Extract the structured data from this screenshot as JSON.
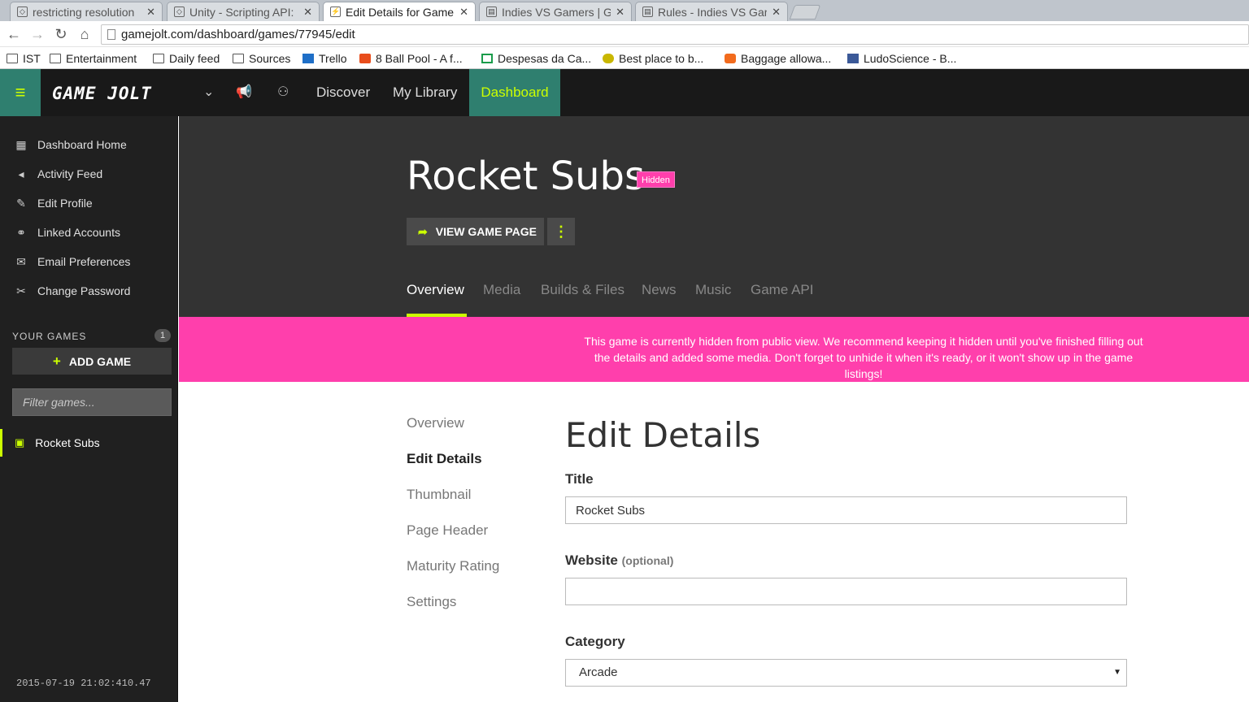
{
  "browser": {
    "tabs": [
      {
        "label": "restricting resolution",
        "favicon": "unity-icon"
      },
      {
        "label": "Unity - Scripting API:",
        "favicon": "unity-icon"
      },
      {
        "label": "Edit Details for Game",
        "favicon": "gamejolt-icon"
      },
      {
        "label": "Indies VS Gamers | G",
        "favicon": "forum-icon"
      },
      {
        "label": "Rules - Indies VS Gar",
        "favicon": "forum-icon"
      }
    ],
    "url": "gamejolt.com/dashboard/games/77945/edit",
    "bookmarks": [
      {
        "label": "IST",
        "icon": "folder-icon"
      },
      {
        "label": "Entertainment",
        "icon": "folder-icon"
      },
      {
        "label": "Daily feed",
        "icon": "folder-icon"
      },
      {
        "label": "Sources",
        "icon": "folder-icon"
      },
      {
        "label": "Trello",
        "icon": "trello-icon"
      },
      {
        "label": "8 Ball Pool - A f...",
        "icon": "play-icon"
      },
      {
        "label": "Despesas da Ca...",
        "icon": "sheets-icon"
      },
      {
        "label": "Best place to b...",
        "icon": "smiley-icon"
      },
      {
        "label": "Baggage allowa...",
        "icon": "e-icon"
      },
      {
        "label": "LudoScience - B...",
        "icon": "facebook-icon"
      }
    ]
  },
  "header": {
    "logo": "GAME JOLT",
    "nav": {
      "discover": "Discover",
      "library": "My Library",
      "dashboard": "Dashboard"
    },
    "accent": "#ccff00",
    "brand": "#2f7f6f"
  },
  "sidebar": {
    "items": [
      {
        "label": "Dashboard Home",
        "icon": "dashboard-icon"
      },
      {
        "label": "Activity Feed",
        "icon": "megaphone-icon"
      },
      {
        "label": "Edit Profile",
        "icon": "pencil-icon"
      },
      {
        "label": "Linked Accounts",
        "icon": "link-icon"
      },
      {
        "label": "Email Preferences",
        "icon": "envelope-icon"
      },
      {
        "label": "Change Password",
        "icon": "tools-icon"
      }
    ],
    "your_games": "YOUR GAMES",
    "games_count": "1",
    "add_game": "ADD GAME",
    "filter_placeholder": "Filter games...",
    "games": [
      "Rocket Subs"
    ]
  },
  "hero": {
    "title": "Rocket Subs",
    "badge": "Hidden",
    "view_game": "VIEW GAME PAGE",
    "tabs": [
      "Overview",
      "Media",
      "Builds & Files",
      "News",
      "Music",
      "Game API"
    ]
  },
  "notice": "This game is currently hidden from public view. We recommend keeping it hidden until you've finished filling out the details and added some media. Don't forget to unhide it when it's ready, or it won't show up in the game listings!",
  "subnav": [
    "Overview",
    "Edit Details",
    "Thumbnail",
    "Page Header",
    "Maturity Rating",
    "Settings"
  ],
  "form": {
    "heading": "Edit Details",
    "title_label": "Title",
    "title_value": "Rocket Subs",
    "website_label": "Website",
    "website_optional": "(optional)",
    "website_value": "",
    "category_label": "Category",
    "category_value": "Arcade"
  },
  "timestamp": "2015-07-19 21:02:410.47"
}
